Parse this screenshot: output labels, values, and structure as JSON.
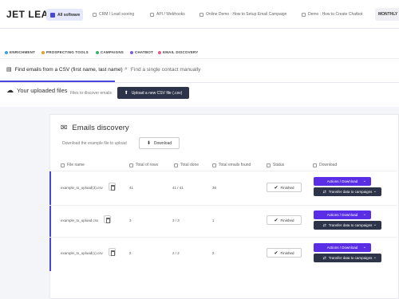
{
  "brand": {
    "logo": "JET LEADS",
    "all_software": "All software"
  },
  "topnav": {
    "links": [
      "CRM / Lead scoring",
      "API / Webhooks",
      "Online Demo : How to Setup Email Campaign",
      "Demo : How to Create Chatbot"
    ],
    "plan": "MONTHLY"
  },
  "subnav": {
    "items": [
      {
        "label": "ENRICHMENT",
        "color": "#3aa0e0"
      },
      {
        "label": "PROSPECTING TOOLS",
        "color": "#e0a030"
      },
      {
        "label": "CAMPAIGNS",
        "color": "#3ab06a"
      },
      {
        "label": "CHATBOT",
        "color": "#7c5ce0"
      },
      {
        "label": "EMAIL DISCOVERY",
        "color": "#e05a8a"
      }
    ]
  },
  "tabs": {
    "csv": "Find emails from a CSV (first name, last name)",
    "single": "Find a single contact manually"
  },
  "uploads": {
    "title": "Your uploaded files",
    "subtitle": "Files to discover emails",
    "upload_button": "Upload a new CSV file (.csv)"
  },
  "discovery": {
    "title": "Emails discovery",
    "example_text": "Download the example file to upload",
    "download_button": "Download"
  },
  "table": {
    "headers": [
      "File name",
      "Total of rows",
      "Total done",
      "Total emails found",
      "Status",
      "Download"
    ],
    "rows": [
      {
        "file": "example_to_upload(3).csv",
        "rows": "41",
        "done": "41 / 41",
        "found": "36",
        "status": "Finished"
      },
      {
        "file": "example_to_upload.csv",
        "rows": "3",
        "done": "3 / 3",
        "found": "1",
        "status": "Finished"
      },
      {
        "file": "example_to_upload(1).csv",
        "rows": "2",
        "done": "2 / 2",
        "found": "2",
        "status": "Finished"
      }
    ],
    "actions_label": "Actions / Download",
    "transfer_label": "Transfer data to campaigns"
  },
  "colors": {
    "accent": "#4a47d8",
    "action_purple": "#5a2ee6",
    "dark_button": "#2d3449"
  }
}
